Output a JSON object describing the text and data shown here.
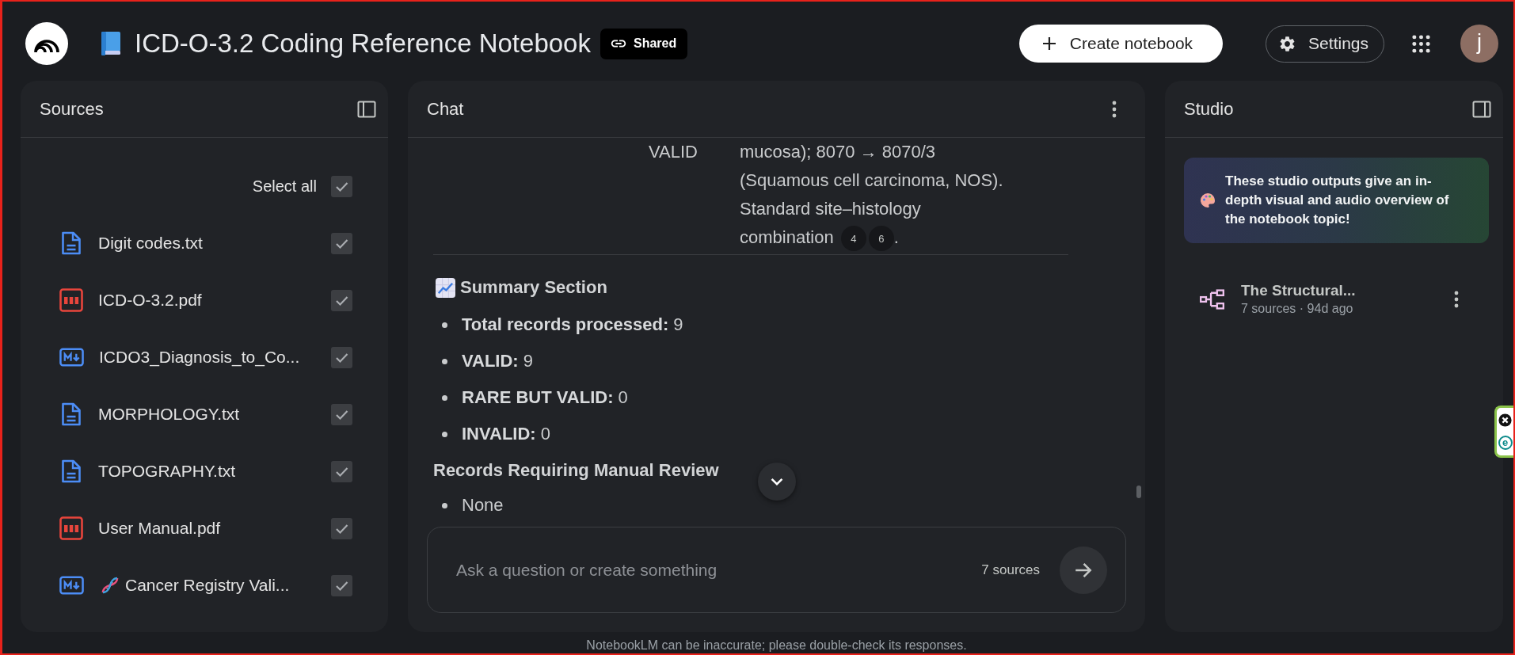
{
  "header": {
    "title": "ICD-O-3.2 Coding Reference Notebook",
    "share_label": "Shared",
    "create_button": "Create notebook",
    "settings_button": "Settings",
    "avatar_letter": "j"
  },
  "sources": {
    "title": "Sources",
    "select_all": {
      "label": "Select all",
      "checked": true
    },
    "items": [
      {
        "name": "Digit codes.txt",
        "kind": "text",
        "checked": true,
        "has_emoji": false
      },
      {
        "name": "ICD-O-3.2.pdf",
        "kind": "pdf",
        "checked": true,
        "has_emoji": false
      },
      {
        "name": "ICDO3_Diagnosis_to_Co...",
        "kind": "markdown",
        "checked": true,
        "has_emoji": false
      },
      {
        "name": "MORPHOLOGY.txt",
        "kind": "text",
        "checked": true,
        "has_emoji": false
      },
      {
        "name": "TOPOGRAPHY.txt",
        "kind": "text",
        "checked": true,
        "has_emoji": false
      },
      {
        "name": "User Manual.pdf",
        "kind": "pdf",
        "checked": true,
        "has_emoji": false
      },
      {
        "name": "Cancer Registry Vali...",
        "kind": "markdown",
        "checked": true,
        "has_emoji": true
      }
    ]
  },
  "chat": {
    "title": "Chat",
    "table_row": {
      "status": "VALID",
      "notes": "mucosa); 8070 → 8070/3 (Squamous cell carcinoma, NOS). Standard site–histology combination",
      "citations": [
        "4",
        "6"
      ],
      "notes_end": "."
    },
    "summary": {
      "heading": "Summary Section",
      "items": [
        "**Total records processed:** 9",
        "**VALID:** 9",
        "**RARE BUT VALID:** 0",
        "**INVALID:** 0"
      ]
    },
    "review": {
      "heading": "Records Requiring Manual Review",
      "items": [
        "None"
      ]
    },
    "composer": {
      "placeholder": "Ask a question or create something",
      "source_count": "7 sources"
    },
    "disclaimer": "NotebookLM can be inaccurate; please double-check its responses."
  },
  "studio": {
    "title": "Studio",
    "banner": "These studio outputs give an in-depth visual and audio overview of the notebook topic!",
    "items": [
      {
        "title": "The Structural...",
        "meta": "7 sources · 94d ago"
      }
    ]
  },
  "extension_widget": {
    "logo_letter": "e"
  }
}
